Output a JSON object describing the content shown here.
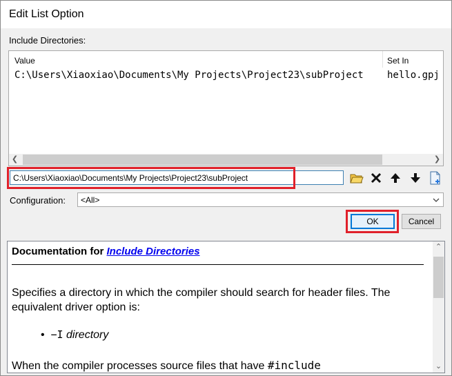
{
  "window": {
    "title": "Edit List Option"
  },
  "include": {
    "group_label": "Include Directories:",
    "columns": {
      "value": "Value",
      "set_in": "Set In"
    },
    "rows": [
      {
        "value": "C:\\Users\\Xiaoxiao\\Documents\\My Projects\\Project23\\subProject",
        "set_in": "hello.gpj"
      }
    ]
  },
  "path_input": {
    "value": "C:\\Users\\Xiaoxiao\\Documents\\My Projects\\Project23\\subProject"
  },
  "toolbar_icons": [
    "browse-folder-icon",
    "delete-icon",
    "move-up-icon",
    "move-down-icon",
    "new-item-icon"
  ],
  "configuration": {
    "label": "Configuration:",
    "selected": "<All>"
  },
  "buttons": {
    "ok": "OK",
    "cancel": "Cancel"
  },
  "doc": {
    "heading_prefix": "Documentation for ",
    "heading_link": "Include Directories",
    "paragraph": "Specifies a directory in which the compiler should search for header files. The equivalent driver option is:",
    "bullet_option": "−I",
    "bullet_arg": "directory",
    "paragraph2_prefix": "When the compiler processes source files that have ",
    "paragraph2_code": "#include"
  },
  "colors": {
    "highlight": "#e0202a",
    "link": "#0000ee",
    "focus": "#0078d7"
  }
}
